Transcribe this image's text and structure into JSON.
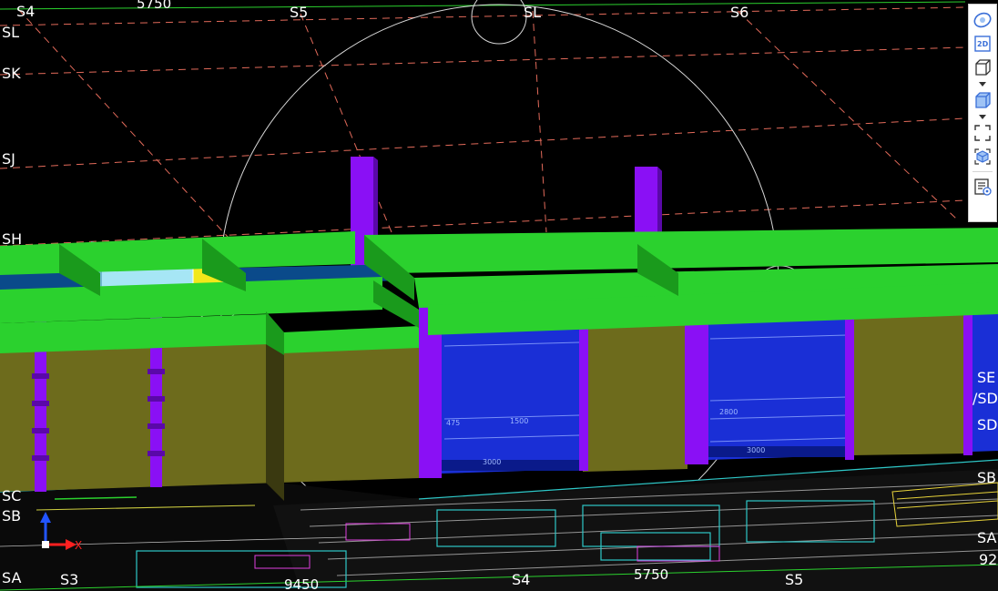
{
  "axis_labels": {
    "top": [
      "S4",
      "S5",
      "SL",
      "S6"
    ],
    "top_dimension": "5750",
    "left": [
      "SL",
      "SK",
      "SJ",
      "SH",
      "SC",
      "SB",
      "SA"
    ],
    "right": [
      "SE",
      "/SD",
      "SD",
      "SB",
      "SA",
      "92"
    ],
    "bottom": [
      "S3",
      "S4",
      "S5"
    ],
    "bottom_dimensions": [
      "9450",
      "5750"
    ]
  },
  "axis_indicator": {
    "x_label": "X"
  },
  "plan_dimensions": {
    "wall_left": [
      "3000",
      "1500",
      "475"
    ],
    "wall_right": [
      "2800",
      "3000"
    ]
  },
  "toolbar": {
    "items": [
      {
        "name": "orbit-icon"
      },
      {
        "name": "view-2d-icon",
        "label": "2D"
      },
      {
        "name": "view-3d-wireframe-icon"
      },
      {
        "name": "view-3d-solid-icon"
      },
      {
        "name": "fit-view-icon"
      },
      {
        "name": "view-cube-icon"
      },
      {
        "name": "properties-panel-icon"
      }
    ]
  },
  "colors": {
    "background": "#000000",
    "beam": "#2bd12e",
    "column": "#8a10f5",
    "wall": "#6d6b1c",
    "glass": "#1a2fd6",
    "selection": "#f2e81a",
    "grid_line": "#e26a5a"
  }
}
